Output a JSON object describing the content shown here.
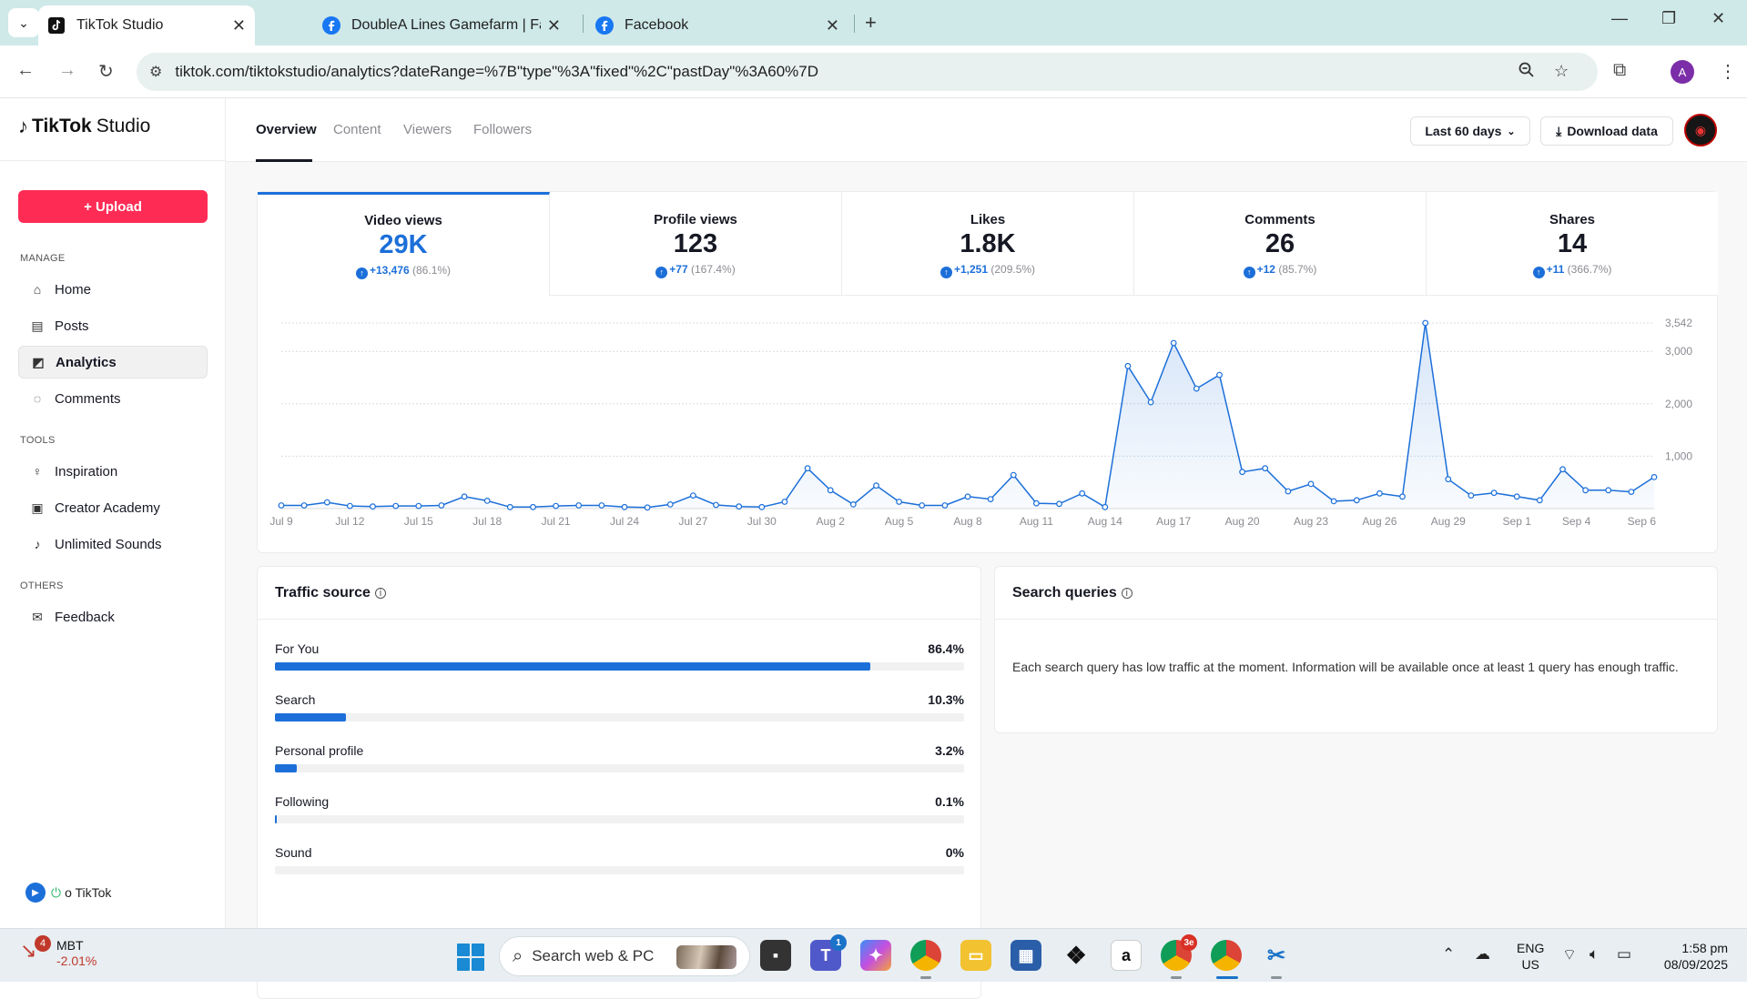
{
  "browser": {
    "tabs": [
      {
        "title": "TikTok Studio",
        "icon": "tiktok-icon",
        "active": true
      },
      {
        "title": "DoubleA Lines Gamefarm | Face",
        "icon": "facebook-icon",
        "active": false
      },
      {
        "title": "Facebook",
        "icon": "facebook-icon",
        "active": false
      }
    ],
    "url": "tiktok.com/tiktokstudio/analytics?dateRange=%7B\"type\"%3A\"fixed\"%2C\"pastDay\"%3A60%7D",
    "profile_initial": "A"
  },
  "sidebar": {
    "logo_brand": "TikTok",
    "logo_suffix": "Studio",
    "upload_label": "+ Upload",
    "sections": {
      "manage": "MANAGE",
      "tools": "TOOLS",
      "others": "OTHERS"
    },
    "items": [
      {
        "label": "Home",
        "icon": "home-icon"
      },
      {
        "label": "Posts",
        "icon": "posts-icon"
      },
      {
        "label": "Analytics",
        "icon": "analytics-icon",
        "active": true
      },
      {
        "label": "Comments",
        "icon": "comments-icon"
      },
      {
        "label": "Inspiration",
        "icon": "bulb-icon"
      },
      {
        "label": "Creator Academy",
        "icon": "academy-icon"
      },
      {
        "label": "Unlimited Sounds",
        "icon": "music-icon"
      },
      {
        "label": "Feedback",
        "icon": "mail-icon"
      }
    ],
    "footer_label": "o TikTok"
  },
  "header": {
    "tabs": [
      "Overview",
      "Content",
      "Viewers",
      "Followers"
    ],
    "active_tab": "Overview",
    "date_range": "Last 60 days",
    "download_label": "Download data"
  },
  "metrics": [
    {
      "label": "Video views",
      "value": "29K",
      "delta": "+13,476",
      "pct": "(86.1%)",
      "active": true
    },
    {
      "label": "Profile views",
      "value": "123",
      "delta": "+77",
      "pct": "(167.4%)"
    },
    {
      "label": "Likes",
      "value": "1.8K",
      "delta": "+1,251",
      "pct": "(209.5%)"
    },
    {
      "label": "Comments",
      "value": "26",
      "delta": "+12",
      "pct": "(85.7%)"
    },
    {
      "label": "Shares",
      "value": "14",
      "delta": "+11",
      "pct": "(366.7%)"
    }
  ],
  "chart_data": {
    "type": "area",
    "series": [
      {
        "values": [
          60,
          60,
          120,
          50,
          40,
          50,
          50,
          60,
          230,
          150,
          30,
          30,
          50,
          60,
          60,
          30,
          20,
          80,
          250,
          70,
          40,
          30,
          130,
          770,
          350,
          80,
          440,
          130,
          60,
          60,
          230,
          180,
          640,
          100,
          90,
          290,
          30,
          2720,
          2030,
          3160,
          2290,
          2550,
          700,
          770,
          330,
          470,
          140,
          160,
          290,
          230,
          3542,
          560,
          250,
          300,
          230,
          160,
          750,
          350,
          350,
          320,
          600
        ]
      }
    ],
    "x_ticks": [
      "Jul 9",
      "Jul 12",
      "Jul 15",
      "Jul 18",
      "Jul 21",
      "Jul 24",
      "Jul 27",
      "Jul 30",
      "Aug 2",
      "Aug 5",
      "Aug 8",
      "Aug 11",
      "Aug 14",
      "Aug 17",
      "Aug 20",
      "Aug 23",
      "Aug 26",
      "Aug 29",
      "Sep 1",
      "Sep 4",
      "Sep 6"
    ],
    "y_ticks": [
      "1,000",
      "2,000",
      "3,000",
      "3,542"
    ],
    "y_tick_values": [
      1000,
      2000,
      3000,
      3542
    ],
    "ylim": [
      0,
      3542
    ],
    "color": "#1c6fd9"
  },
  "traffic": {
    "title": "Traffic source",
    "rows": [
      {
        "label": "For You",
        "pct": "86.4%",
        "fraction": 0.864
      },
      {
        "label": "Search",
        "pct": "10.3%",
        "fraction": 0.103
      },
      {
        "label": "Personal profile",
        "pct": "3.2%",
        "fraction": 0.032
      },
      {
        "label": "Following",
        "pct": "0.1%",
        "fraction": 0.001
      },
      {
        "label": "Sound",
        "pct": "0%",
        "fraction": 0
      }
    ]
  },
  "search_queries": {
    "title": "Search queries",
    "message": "Each search query has low traffic at the moment. Information will be available once at least 1 query has enough traffic."
  },
  "taskbar": {
    "stock_symbol": "MBT",
    "stock_change": "-2.01%",
    "stock_badge": "4",
    "search_placeholder": "Search web & PC",
    "teams_badge": "1",
    "chrome_badge": "3e",
    "lang": "ENG",
    "region": "US",
    "time": "1:58 pm",
    "date": "08/09/2025"
  }
}
